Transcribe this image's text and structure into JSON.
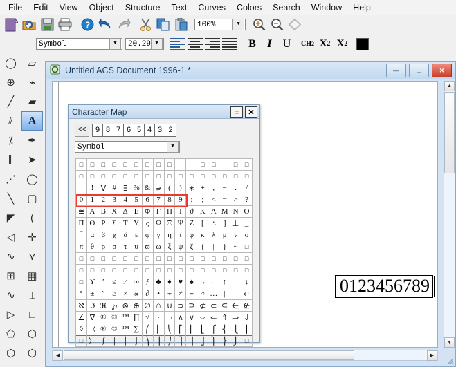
{
  "menubar": {
    "items": [
      "File",
      "Edit",
      "View",
      "Object",
      "Structure",
      "Text",
      "Curves",
      "Colors",
      "Search",
      "Window",
      "Help"
    ]
  },
  "toolbar": {
    "icons": [
      {
        "name": "new-document-icon",
        "glyph": "▮"
      },
      {
        "name": "open-file-icon",
        "glyph": "▤"
      },
      {
        "name": "save-icon",
        "glyph": "▣"
      },
      {
        "name": "print-icon",
        "glyph": "▭"
      },
      {
        "name": "help-icon",
        "glyph": "?"
      },
      {
        "name": "undo-icon",
        "glyph": "↰"
      },
      {
        "name": "redo-icon",
        "glyph": "↱"
      },
      {
        "name": "cut-icon",
        "glyph": "✂"
      },
      {
        "name": "copy-icon",
        "glyph": "❐"
      },
      {
        "name": "paste-icon",
        "glyph": "📋"
      }
    ],
    "zoom_value": "100%",
    "zoom_in_label": "+",
    "zoom_out_label": "−",
    "diamond_label": "◇"
  },
  "format_bar": {
    "font_name": "Symbol",
    "font_size": "20.29",
    "bold_label": "B",
    "italic_label": "I",
    "underline_label": "U",
    "subformula_label": "CH2",
    "subscript_label": "X2",
    "superscript_label": "X2",
    "color_swatch": "#000000"
  },
  "palette": {
    "tools": [
      {
        "name": "lasso-tool",
        "glyph": "◯"
      },
      {
        "name": "marquee-select-tool",
        "glyph": "▱"
      },
      {
        "name": "rotate-tool",
        "glyph": "⊕"
      },
      {
        "name": "bond-dash-tool",
        "glyph": "⌁"
      },
      {
        "name": "single-bond-tool",
        "glyph": "╱"
      },
      {
        "name": "eraser-tool",
        "glyph": "▰"
      },
      {
        "name": "double-bond-tool",
        "glyph": "⫽"
      },
      {
        "name": "text-tool",
        "glyph": "A",
        "active": true
      },
      {
        "name": "dashed-bond-tool",
        "glyph": "⁒"
      },
      {
        "name": "pen-tool",
        "glyph": "✒"
      },
      {
        "name": "hash-bond-tool",
        "glyph": "⫼"
      },
      {
        "name": "arrow-tool",
        "glyph": "➤"
      },
      {
        "name": "dotted-bond-tool",
        "glyph": "⋰"
      },
      {
        "name": "circle-tool",
        "glyph": "◯"
      },
      {
        "name": "bold-bond-tool",
        "glyph": "╲"
      },
      {
        "name": "rounded-rect-tool",
        "glyph": "▢"
      },
      {
        "name": "wedge-bond-tool",
        "glyph": "◤"
      },
      {
        "name": "arc-tool",
        "glyph": "("
      },
      {
        "name": "hashed-wedge-tool",
        "glyph": "◁"
      },
      {
        "name": "plus-tool",
        "glyph": "✛"
      },
      {
        "name": "squiggle-bond-tool",
        "glyph": "∿"
      },
      {
        "name": "orbital-tool",
        "glyph": "⋎"
      },
      {
        "name": "table-tool",
        "glyph": "⊞"
      },
      {
        "name": "pattern-fill-tool",
        "glyph": "▦"
      },
      {
        "name": "chain-tool",
        "glyph": "∿"
      },
      {
        "name": "stamp-tool",
        "glyph": "⌶"
      },
      {
        "name": "triangle-tool",
        "glyph": "▷"
      },
      {
        "name": "square-tool",
        "glyph": "□"
      },
      {
        "name": "pentagon-tool",
        "glyph": "⬠"
      },
      {
        "name": "hexagon-tool",
        "glyph": "⬡"
      },
      {
        "name": "heptagon-tool",
        "glyph": "⬡"
      },
      {
        "name": "octagon-tool",
        "glyph": "⬡"
      }
    ]
  },
  "document_window": {
    "title": "Untitled ACS Document 1996-1 *",
    "app_icon": "acs-document-icon",
    "minimize_label": "—",
    "restore_label": "❐",
    "close_label": "✕",
    "text_object_value": "0123456789"
  },
  "character_map": {
    "title": "Character Map",
    "collapse_label": "=",
    "close_label": "✕",
    "prev_page_label": "<<",
    "pages": [
      "9",
      "8",
      "7",
      "6",
      "5",
      "4",
      "3",
      "2"
    ],
    "font_name": "Symbol",
    "highlight_color": "#e83b2f",
    "grid": [
      [
        "□",
        "□",
        "□",
        "□",
        "□",
        "□",
        "□",
        "□",
        "□",
        "",
        "",
        "□",
        "□",
        "",
        "□",
        "□"
      ],
      [
        "□",
        "□",
        "□",
        "□",
        "□",
        "□",
        "□",
        "□",
        "□",
        "□",
        "□",
        "□",
        "□",
        "□",
        "□",
        "□"
      ],
      [
        "",
        "!",
        "∀",
        "#",
        "∃",
        "%",
        "&",
        "∍",
        "(",
        ")",
        "∗",
        "+",
        ",",
        "−",
        ".",
        "/"
      ],
      [
        "0",
        "1",
        "2",
        "3",
        "4",
        "5",
        "6",
        "7",
        "8",
        "9",
        ":",
        ";",
        "<",
        "=",
        ">",
        "?"
      ],
      [
        "≅",
        "Α",
        "Β",
        "Χ",
        "Δ",
        "Ε",
        "Φ",
        "Γ",
        "Η",
        "Ι",
        "ϑ",
        "Κ",
        "Λ",
        "Μ",
        "Ν",
        "Ο"
      ],
      [
        "Π",
        "Θ",
        "Ρ",
        "Σ",
        "Τ",
        "Υ",
        "ς",
        "Ω",
        "Ξ",
        "Ψ",
        "Ζ",
        "[",
        "∴",
        "]",
        "⊥",
        "_"
      ],
      [
        "‾",
        "α",
        "β",
        "χ",
        "δ",
        "ε",
        "φ",
        "γ",
        "η",
        "ι",
        "φ",
        "κ",
        "λ",
        "μ",
        "ν",
        "ο"
      ],
      [
        "π",
        "θ",
        "ρ",
        "σ",
        "τ",
        "υ",
        "ϖ",
        "ω",
        "ξ",
        "ψ",
        "ζ",
        "{",
        "|",
        "}",
        "~",
        "□"
      ],
      [
        "□",
        "□",
        "□",
        "□",
        "□",
        "□",
        "□",
        "□",
        "□",
        "□",
        "□",
        "□",
        "□",
        "□",
        "□",
        "□"
      ],
      [
        "□",
        "□",
        "□",
        "□",
        "□",
        "□",
        "□",
        "□",
        "□",
        "□",
        "□",
        "□",
        "□",
        "□",
        "□",
        "□"
      ],
      [
        "□",
        "ϒ",
        "′",
        "≤",
        "⁄",
        "∞",
        "ƒ",
        "♣",
        "♦",
        "♥",
        "♠",
        "↔",
        "←",
        "↑",
        "→",
        "↓"
      ],
      [
        "°",
        "±",
        "″",
        "≥",
        "×",
        "∝",
        "∂",
        "•",
        "÷",
        "≠",
        "≡",
        "≈",
        "…",
        "|",
        "—",
        "↵"
      ],
      [
        "ℵ",
        "ℑ",
        "ℜ",
        "℘",
        "⊗",
        "⊕",
        "∅",
        "∩",
        "∪",
        "⊃",
        "⊇",
        "⊄",
        "⊂",
        "⊆",
        "∈",
        "∉"
      ],
      [
        "∠",
        "∇",
        "®",
        "©",
        "™",
        "∏",
        "√",
        "⋅",
        "¬",
        "∧",
        "∨",
        "⇔",
        "⇐",
        "⇑",
        "⇒",
        "⇓"
      ],
      [
        "◊",
        "〈",
        "®",
        "©",
        "™",
        "∑",
        "⎛",
        "⎜",
        "⎝",
        "⎡",
        "⎢",
        "⎣",
        "⎧",
        "⎨",
        "⎩",
        "⎪"
      ],
      [
        "□",
        "〉",
        "∫",
        "⌠",
        "⎮",
        "⌡",
        "⎞",
        "⎟",
        "⎠",
        "⎤",
        "⎥",
        "⎦",
        "⎫",
        "⎬",
        "⎭",
        "□"
      ]
    ],
    "highlight_row": 3,
    "highlight_start_col": 0,
    "highlight_end_col": 9
  }
}
